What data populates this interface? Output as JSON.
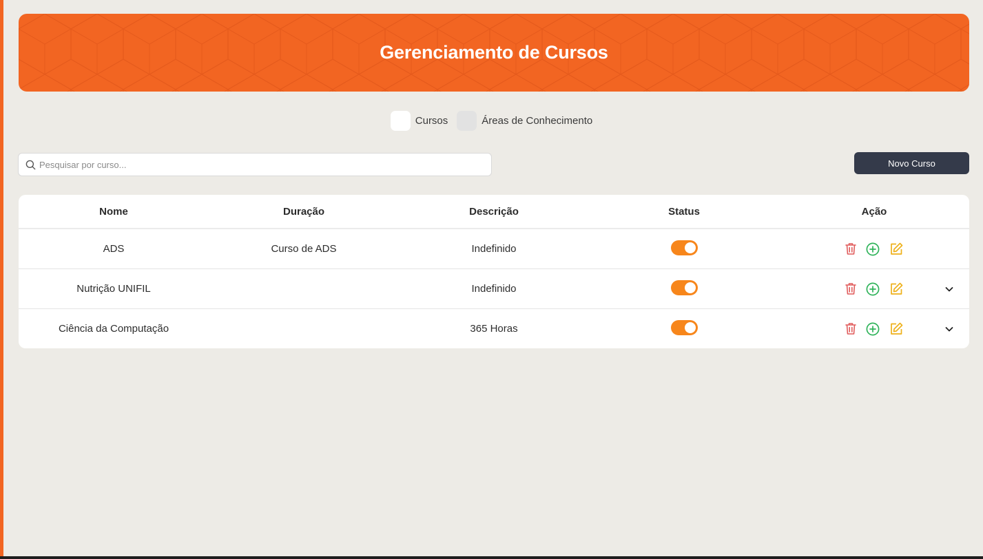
{
  "header": {
    "title": "Gerenciamento de Cursos"
  },
  "tabs": [
    {
      "label": "Cursos",
      "active": true
    },
    {
      "label": "Áreas de Conhecimento",
      "active": false
    }
  ],
  "search": {
    "placeholder": "Pesquisar por curso...",
    "value": ""
  },
  "toolbar": {
    "new_label": "Novo Curso"
  },
  "table": {
    "columns": [
      "Nome",
      "Duração",
      "Descrição",
      "Status",
      "Ação"
    ],
    "rows": [
      {
        "nome": "ADS",
        "duracao": "Curso de ADS",
        "descricao": "Indefinido",
        "status": true,
        "expandable": false
      },
      {
        "nome": "Nutrição UNIFIL",
        "duracao": "",
        "descricao": "Indefinido",
        "status": true,
        "expandable": true
      },
      {
        "nome": "Ciência da Computação",
        "duracao": "",
        "descricao": "365 Horas",
        "status": true,
        "expandable": true
      }
    ]
  },
  "colors": {
    "brand": "#f26522",
    "toggle_on": "#f7861b",
    "delete": "#e05a5a",
    "add": "#2fb35a",
    "edit": "#eeb11b",
    "button": "#343a4a"
  },
  "icons": [
    "search-icon",
    "trash-icon",
    "plus-circle-icon",
    "edit-icon",
    "chevron-down-icon"
  ]
}
